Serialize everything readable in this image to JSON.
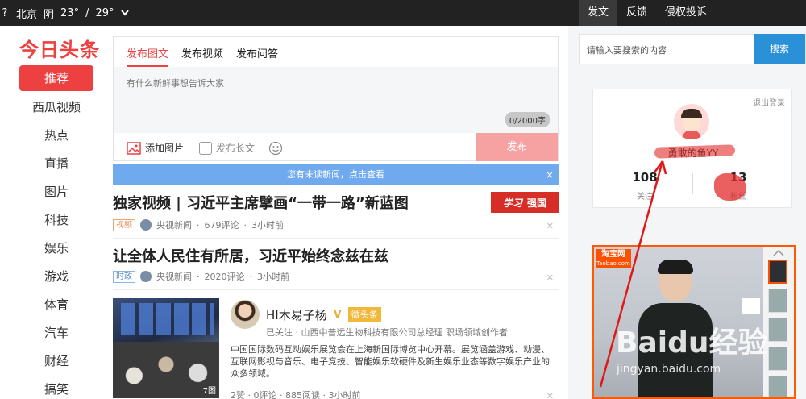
{
  "topbar": {
    "location": "北京",
    "weather": "阴",
    "temp_low": "23°",
    "temp_sep": "/",
    "temp_high": "29°",
    "links": [
      "发文",
      "反馈",
      "侵权投诉"
    ]
  },
  "logo": "今日头条",
  "nav": [
    "推荐",
    "西瓜视频",
    "热点",
    "直播",
    "图片",
    "科技",
    "娱乐",
    "游戏",
    "体育",
    "汽车",
    "财经",
    "搞笑"
  ],
  "publish": {
    "tabs": [
      "发布图文",
      "发布视频",
      "发布问答"
    ],
    "placeholder": "有什么新鲜事想告诉大家",
    "counter": "0/2000字",
    "add_image": "添加图片",
    "long_text": "发布长文",
    "submit": "发布"
  },
  "notice": {
    "text": "您有未读新闻，点击查看",
    "close": "×"
  },
  "articles": [
    {
      "title": "独家视频 | 习近平主席擘画“一带一路”新蓝图",
      "tag": "视频",
      "source": "央视新闻",
      "comments": "679评论",
      "time": "3小时前",
      "banner_logo": "学习",
      "banner_text": "强国"
    },
    {
      "title": "让全体人民住有所居，习近平始终念兹在兹",
      "tag": "时政",
      "source": "央视新闻",
      "comments": "2020评论",
      "time": "3小时前"
    },
    {
      "author": "HI木易子杨",
      "verified": "V",
      "badge": "微头条",
      "author_sub": "已关注 · 山西中普远生物科技有限公司总经理 职场领域创作者",
      "summary": "中国国际数码互动娱乐展览会在上海新国际博览中心开幕。展览涵盖游戏、动漫、互联网影视与音乐、电子竞技、智能娱乐软硬件及新生娱乐业态等数字娱乐产业的众多领域。",
      "image_count": "7图",
      "stats": "2赞 · 0评论 · 885阅读 · 3小时前"
    }
  ],
  "search": {
    "placeholder": "请输入要搜索的内容",
    "button": "搜索"
  },
  "user": {
    "logout": "退出登录",
    "name": "勇敢的鱼YY",
    "following": "108",
    "following_label": "关注",
    "fans": "13",
    "fans_label": "粉丝"
  },
  "ad": {
    "brand": "淘宝网",
    "brand_sub": "Taobao.com"
  },
  "watermark": {
    "main": "Baidu经验",
    "sub": "jingyan.baidu.com"
  },
  "colors": {
    "accent": "#ed4040",
    "notice": "#6fa9ee",
    "search_btn": "#2a90d7",
    "taobao": "#ff5000"
  }
}
